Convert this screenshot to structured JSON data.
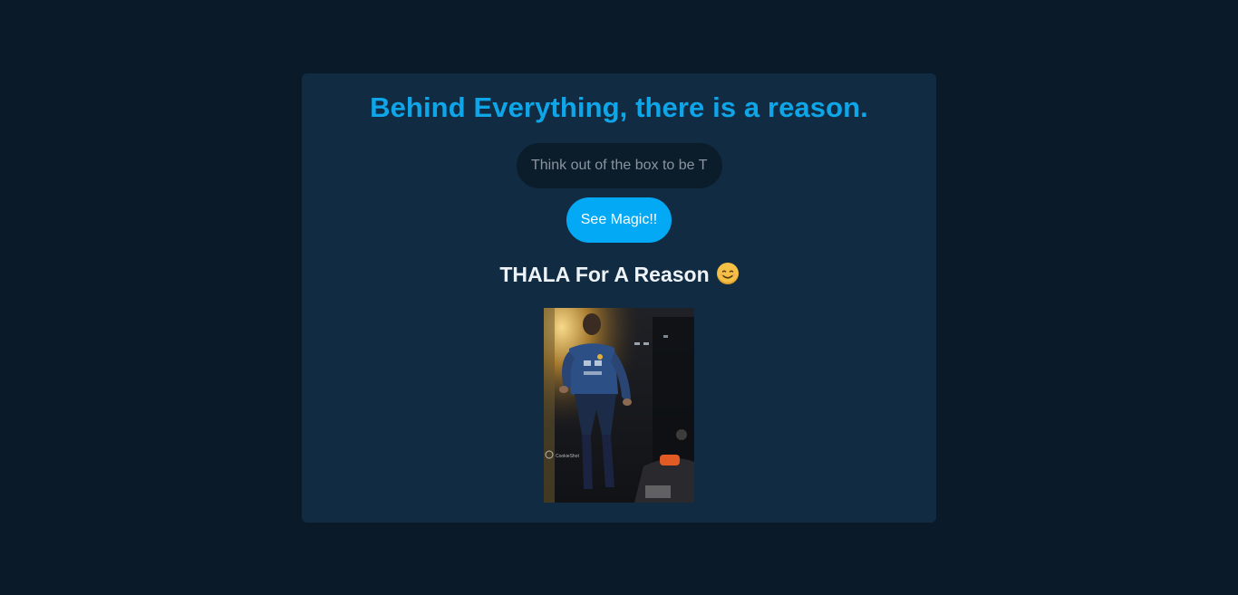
{
  "card": {
    "heading": "Behind Everything, there is a reason.",
    "input_placeholder": "Think out of the box to be THALA",
    "button_label": "See Magic!!",
    "result_title": "THALA For A Reason",
    "result_emoji": "smiling-face-icon",
    "gif": {
      "watermark": "CookieShot"
    }
  },
  "colors": {
    "page_background": "#0a1a28",
    "card_background": "#112c42",
    "accent": "#03a9f4",
    "heading": "#0ea5e9",
    "input_background": "#0b1c2a"
  }
}
